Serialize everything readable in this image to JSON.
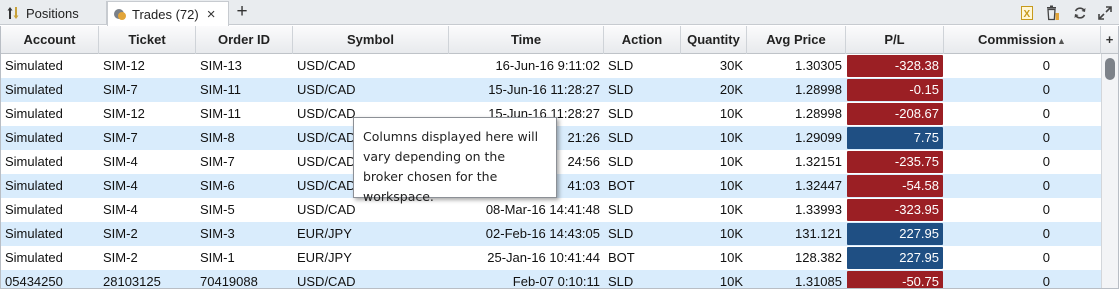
{
  "tabs": [
    {
      "label": "Positions"
    },
    {
      "label": "Trades (72)"
    }
  ],
  "icons": {
    "positions_tab": "up-down-arrows-icon",
    "trades_tab": "trades-icon",
    "close": "close-icon",
    "add_tab": "plus-icon",
    "export": "export-excel-icon",
    "delete": "trash-icon",
    "refresh": "refresh-icon",
    "expand": "expand-icon",
    "add_column": "plus-icon",
    "sort": "sort-ascending-icon"
  },
  "symbols": {
    "close": "×",
    "add_tab": "+",
    "add_column": "+",
    "sort_asc": "▲"
  },
  "colors": {
    "row_alt": "#d9ecfc",
    "pl_negative": "#9b1f24",
    "pl_positive": "#1f4f83"
  },
  "columns": [
    "Account",
    "Ticket",
    "Order ID",
    "Symbol",
    "Time",
    "Action",
    "Quantity",
    "Avg Price",
    "P/L",
    "Commission"
  ],
  "rows": [
    {
      "account": "Simulated",
      "ticket": "SIM-12",
      "order_id": "SIM-13",
      "symbol": "USD/CAD",
      "time": "16-Jun-16 9:11:02",
      "action": "SLD",
      "quantity": "30K",
      "avg_price": "1.30305",
      "pl": "-328.38",
      "pl_sign": "neg",
      "commission": "0"
    },
    {
      "account": "Simulated",
      "ticket": "SIM-7",
      "order_id": "SIM-11",
      "symbol": "USD/CAD",
      "time": "15-Jun-16 11:28:27",
      "action": "SLD",
      "quantity": "20K",
      "avg_price": "1.28998",
      "pl": "-0.15",
      "pl_sign": "neg",
      "commission": "0"
    },
    {
      "account": "Simulated",
      "ticket": "SIM-12",
      "order_id": "SIM-11",
      "symbol": "USD/CAD",
      "time": "15-Jun-16 11:28:27",
      "action": "SLD",
      "quantity": "10K",
      "avg_price": "1.28998",
      "pl": "-208.67",
      "pl_sign": "neg",
      "commission": "0"
    },
    {
      "account": "Simulated",
      "ticket": "SIM-7",
      "order_id": "SIM-8",
      "symbol": "USD/CAD",
      "time": "21:26",
      "action": "SLD",
      "quantity": "10K",
      "avg_price": "1.29099",
      "pl": "7.75",
      "pl_sign": "pos",
      "commission": "0"
    },
    {
      "account": "Simulated",
      "ticket": "SIM-4",
      "order_id": "SIM-7",
      "symbol": "USD/CAD",
      "time": "24:56",
      "action": "SLD",
      "quantity": "10K",
      "avg_price": "1.32151",
      "pl": "-235.75",
      "pl_sign": "neg",
      "commission": "0"
    },
    {
      "account": "Simulated",
      "ticket": "SIM-4",
      "order_id": "SIM-6",
      "symbol": "USD/CAD",
      "time": "41:03",
      "action": "BOT",
      "quantity": "10K",
      "avg_price": "1.32447",
      "pl": "-54.58",
      "pl_sign": "neg",
      "commission": "0"
    },
    {
      "account": "Simulated",
      "ticket": "SIM-4",
      "order_id": "SIM-5",
      "symbol": "USD/CAD",
      "time": "08-Mar-16 14:41:48",
      "action": "SLD",
      "quantity": "10K",
      "avg_price": "1.33993",
      "pl": "-323.95",
      "pl_sign": "neg",
      "commission": "0"
    },
    {
      "account": "Simulated",
      "ticket": "SIM-2",
      "order_id": "SIM-3",
      "symbol": "EUR/JPY",
      "time": "02-Feb-16 14:43:05",
      "action": "SLD",
      "quantity": "10K",
      "avg_price": "131.121",
      "pl": "227.95",
      "pl_sign": "pos",
      "commission": "0"
    },
    {
      "account": "Simulated",
      "ticket": "SIM-2",
      "order_id": "SIM-1",
      "symbol": "EUR/JPY",
      "time": "25-Jan-16 10:41:44",
      "action": "BOT",
      "quantity": "10K",
      "avg_price": "128.382",
      "pl": "227.95",
      "pl_sign": "pos",
      "commission": "0"
    },
    {
      "account": "05434250",
      "ticket": "28103125",
      "order_id": "70419088",
      "symbol": "USD/CAD",
      "time": "Feb-07 0:10:11",
      "action": "SLD",
      "quantity": "10K",
      "avg_price": "1.31085",
      "pl": "-50.75",
      "pl_sign": "neg",
      "commission": "0"
    }
  ],
  "tooltip": {
    "text": "Columns displayed here will vary depending on the broker chosen for the workspace."
  }
}
